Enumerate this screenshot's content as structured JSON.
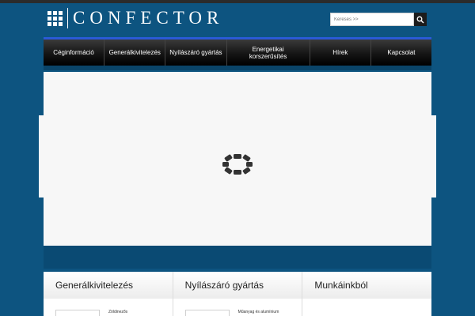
{
  "brand": {
    "name": "CONFECTOR"
  },
  "search": {
    "placeholder": "Keresés >>"
  },
  "nav": {
    "items": [
      {
        "label": "Céginformáció"
      },
      {
        "label": "Generálkivitelezés"
      },
      {
        "label": "Nyílászáró gyártás"
      },
      {
        "label": "Energetikai korszerűsítés"
      },
      {
        "label": "Hírek"
      },
      {
        "label": "Kapcsolat"
      }
    ]
  },
  "columns": [
    {
      "title": "Generálkivitelezés",
      "snippet": "Zöldinezős"
    },
    {
      "title": "Nyílászáró gyártás",
      "snippet": "Műanyag és alumínium"
    },
    {
      "title": "Munkáinkból",
      "snippet": ""
    }
  ],
  "colors": {
    "background": "#0d5480",
    "nav_accent": "#2a5ad6",
    "band": "#0a4a73"
  }
}
